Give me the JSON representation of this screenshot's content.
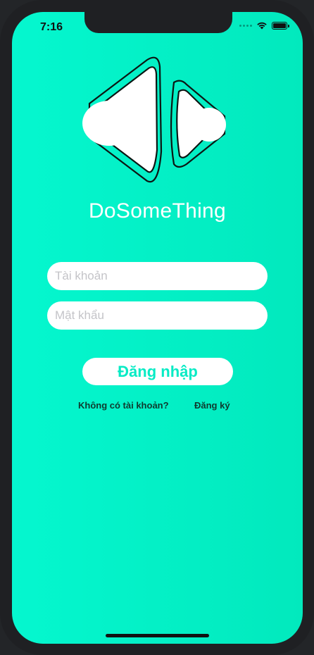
{
  "status_bar": {
    "time": "7:16",
    "icons": [
      "signal-dots-icon",
      "wifi-icon",
      "battery-icon"
    ]
  },
  "logo": {
    "icon": "double-play-logo"
  },
  "app": {
    "title": "DoSomeThing"
  },
  "login_form": {
    "username_placeholder": "Tài khoản",
    "username_value": "",
    "password_placeholder": "Mật khẩu",
    "password_value": "",
    "login_button_label": "Đăng nhập"
  },
  "signup_prompt": {
    "question": "Không có tài khoản?",
    "register_label": "Đăng ký"
  },
  "colors": {
    "background_start": "#05f7cf",
    "background_end": "#02e9bd",
    "button_text": "#07ebc5",
    "field_background": "#ffffff"
  }
}
